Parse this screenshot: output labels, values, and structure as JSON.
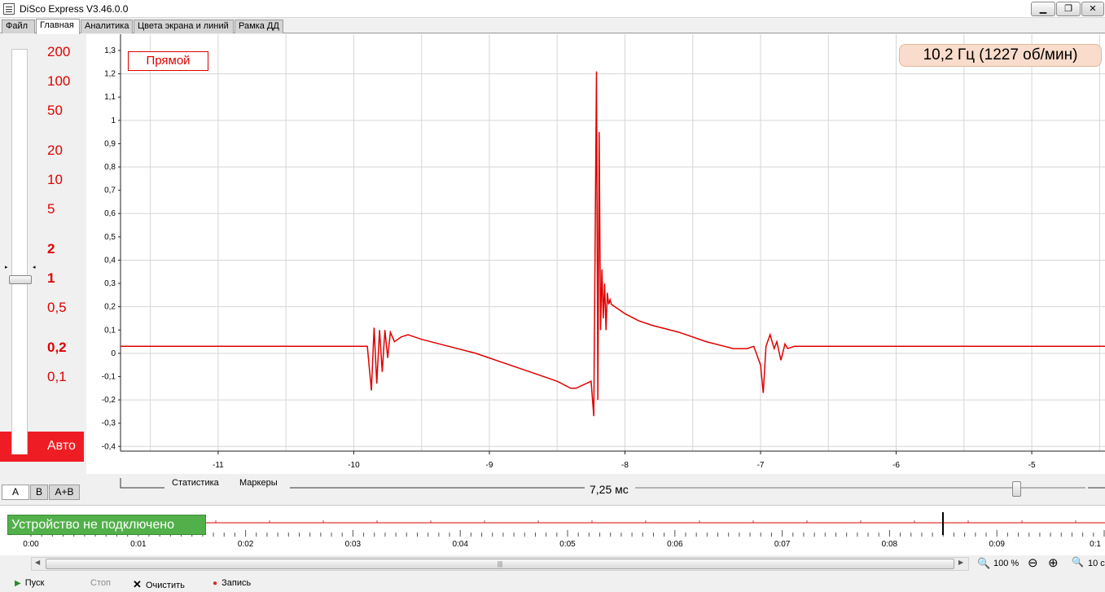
{
  "window": {
    "title": "DiSco Express V3.46.0.0",
    "minimize_glyph": "▁",
    "maximize_glyph": "❐",
    "close_glyph": "✕"
  },
  "menu_tabs": [
    "Файл",
    "Главная",
    "Аналитика",
    "Цвета экрана и линий",
    "Рамка ДД"
  ],
  "scale_panel": {
    "labels": [
      "200",
      "100",
      "50",
      "20",
      "10",
      "5",
      "2",
      "1",
      "0,5",
      "0,2",
      "0,1"
    ],
    "auto_label": "Авто",
    "channel_tabs": [
      "A",
      "B",
      "A+B"
    ]
  },
  "chart_data": {
    "type": "line",
    "mode_label": "Прямой",
    "frequency_label": "10,2 Гц (1227 об/мин)",
    "x_ticks": [
      -11,
      -10,
      -9,
      -8,
      -7,
      -6,
      -5
    ],
    "y_ticks": [
      "1,3",
      "1,2",
      "1,1",
      "1",
      "0,9",
      "0,8",
      "0,7",
      "0,6",
      "0,5",
      "0,4",
      "0,3",
      "0,2",
      "0,1",
      "0",
      "-0,1",
      "-0,2",
      "-0,3",
      "-0,4"
    ],
    "xlim": [
      -11.72,
      -4.46
    ],
    "ylim": [
      -0.42,
      1.37
    ],
    "grid": true,
    "series": [
      {
        "color": "#e00000",
        "x": [
          -11.72,
          -10.5,
          -9.9,
          -9.87,
          -9.85,
          -9.83,
          -9.81,
          -9.79,
          -9.77,
          -9.75,
          -9.73,
          -9.7,
          -9.65,
          -9.6,
          -9.5,
          -9.3,
          -9.1,
          -8.9,
          -8.7,
          -8.5,
          -8.4,
          -8.36,
          -8.25,
          -8.23,
          -8.21,
          -8.2,
          -8.19,
          -8.18,
          -8.17,
          -8.16,
          -8.15,
          -8.14,
          -8.13,
          -8.12,
          -8.11,
          -8.1,
          -8.05,
          -8.0,
          -7.9,
          -7.8,
          -7.6,
          -7.4,
          -7.2,
          -7.1,
          -7.05,
          -7.0,
          -6.98,
          -6.96,
          -6.93,
          -6.9,
          -6.88,
          -6.85,
          -6.82,
          -6.8,
          -6.75,
          -6.7,
          -6.5,
          -6.0,
          -5.5,
          -5.0,
          -4.46
        ],
        "y": [
          0.03,
          0.03,
          0.03,
          -0.16,
          0.11,
          -0.13,
          0.1,
          -0.08,
          0.1,
          -0.02,
          0.09,
          0.05,
          0.07,
          0.08,
          0.06,
          0.03,
          0.0,
          -0.04,
          -0.08,
          -0.12,
          -0.15,
          -0.15,
          -0.12,
          -0.27,
          1.21,
          -0.2,
          0.95,
          0.1,
          0.36,
          0.15,
          0.3,
          0.1,
          0.26,
          0.21,
          0.23,
          0.21,
          0.19,
          0.17,
          0.14,
          0.12,
          0.09,
          0.05,
          0.02,
          0.02,
          0.03,
          -0.05,
          -0.17,
          0.03,
          0.08,
          0.02,
          0.05,
          -0.03,
          0.04,
          0.02,
          0.03,
          0.03,
          0.03,
          0.03,
          0.03,
          0.03,
          0.03
        ]
      }
    ]
  },
  "statistics": {
    "stats_label": "Статистика",
    "markers_label": "Маркеры",
    "time_scale": "7,25 мс"
  },
  "timeline": {
    "status": "Устройство не подключено",
    "ticks": [
      "0:00",
      "0:01",
      "0:02",
      "0:03",
      "0:04",
      "0:05",
      "0:06",
      "0:07",
      "0:08",
      "0:09",
      "0:1"
    ]
  },
  "zoom": {
    "scroll_grip": "|||",
    "level": "100 %",
    "duration": "10 с"
  },
  "toolbar": {
    "play": "Пуск",
    "stop": "Стоп",
    "clear": "Очистить",
    "record": "Запись"
  }
}
